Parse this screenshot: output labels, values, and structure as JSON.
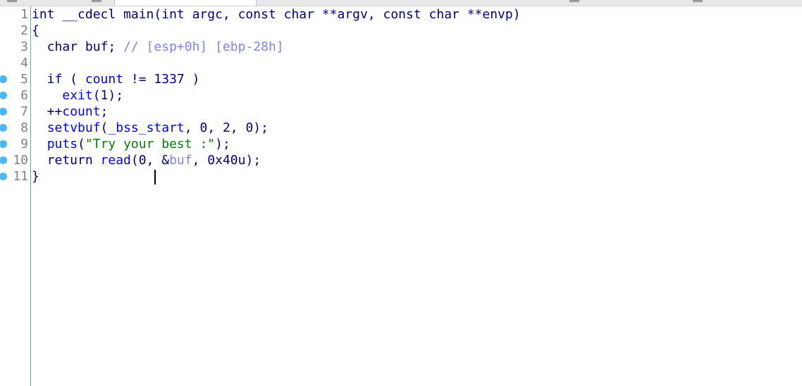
{
  "editor": {
    "lines": [
      {
        "num": "1",
        "bp": false,
        "tokens": [
          [
            "int __cdecl main(int argc, const char **argv, const char **envp)",
            "kw"
          ]
        ]
      },
      {
        "num": "2",
        "bp": false,
        "tokens": [
          [
            "{",
            "kw"
          ]
        ]
      },
      {
        "num": "3",
        "bp": false,
        "tokens": [
          [
            "  char buf; ",
            "kw"
          ],
          [
            "// [esp+0h] [ebp-28h]",
            "cm"
          ]
        ]
      },
      {
        "num": "4",
        "bp": false,
        "tokens": []
      },
      {
        "num": "5",
        "bp": true,
        "tokens": [
          [
            "  if ( ",
            "kw"
          ],
          [
            "count",
            "var"
          ],
          [
            " != 1337 )",
            "kw"
          ]
        ]
      },
      {
        "num": "6",
        "bp": true,
        "tokens": [
          [
            "    ",
            "kw"
          ],
          [
            "exit",
            "fn"
          ],
          [
            "(1);",
            "kw"
          ]
        ]
      },
      {
        "num": "7",
        "bp": true,
        "tokens": [
          [
            "  ++",
            "kw"
          ],
          [
            "count",
            "var"
          ],
          [
            ";",
            "kw"
          ]
        ]
      },
      {
        "num": "8",
        "bp": true,
        "tokens": [
          [
            "  ",
            "kw"
          ],
          [
            "setvbuf",
            "fn"
          ],
          [
            "(",
            "kw"
          ],
          [
            "_bss_start",
            "var"
          ],
          [
            ", 0, 2, 0);",
            "kw"
          ]
        ]
      },
      {
        "num": "9",
        "bp": true,
        "tokens": [
          [
            "  ",
            "kw"
          ],
          [
            "puts",
            "fn"
          ],
          [
            "(",
            "kw"
          ],
          [
            "\"Try your best :\"",
            "str"
          ],
          [
            ");",
            "kw"
          ]
        ]
      },
      {
        "num": "10",
        "bp": true,
        "tokens": [
          [
            "  return ",
            "kw"
          ],
          [
            "read",
            "fn"
          ],
          [
            "(0, &",
            "kw"
          ],
          [
            "buf",
            "lv"
          ],
          [
            ", 0x40u);",
            "kw"
          ]
        ]
      },
      {
        "num": "11",
        "bp": true,
        "tokens": [
          [
            "}",
            "kw"
          ]
        ]
      }
    ],
    "colors": {
      "breakpoint": "#4db8f0",
      "default": "#000080",
      "function": "#0000ff",
      "string": "#008000",
      "comment": "#8080ff"
    }
  }
}
